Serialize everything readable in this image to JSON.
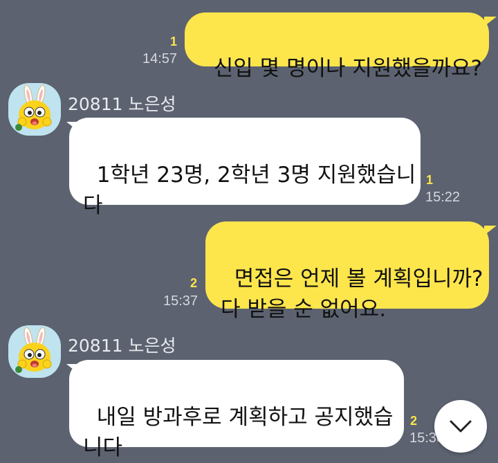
{
  "chat": {
    "messages": [
      {
        "direction": "outgoing",
        "text": "신입 몇 명이나 지원했을까요?",
        "unread": "1",
        "time": "14:57"
      },
      {
        "direction": "incoming",
        "sender": "20811 노은성",
        "text": "1학년 23명, 2학년 3명 지원했습니\n다",
        "unread": "1",
        "time": "15:22"
      },
      {
        "direction": "outgoing",
        "text": "면접은 언제 볼 계획입니까?\n다 받을 순 없어요.",
        "unread": "2",
        "time": "15:37"
      },
      {
        "direction": "incoming",
        "sender": "20811 노은성",
        "text": "내일 방과후로 계획하고 공지했습\n니다",
        "unread": "2",
        "time": "15:38"
      }
    ]
  },
  "icons": {
    "avatar": "yellow-bunny-character-icon",
    "scroll_down": "chevron-down-icon"
  },
  "colors": {
    "background": "#5c6270",
    "outgoing_bubble": "#fde54c",
    "incoming_bubble": "#ffffff",
    "unread_count": "#fde54c",
    "avatar_background": "#bfe3ef"
  }
}
